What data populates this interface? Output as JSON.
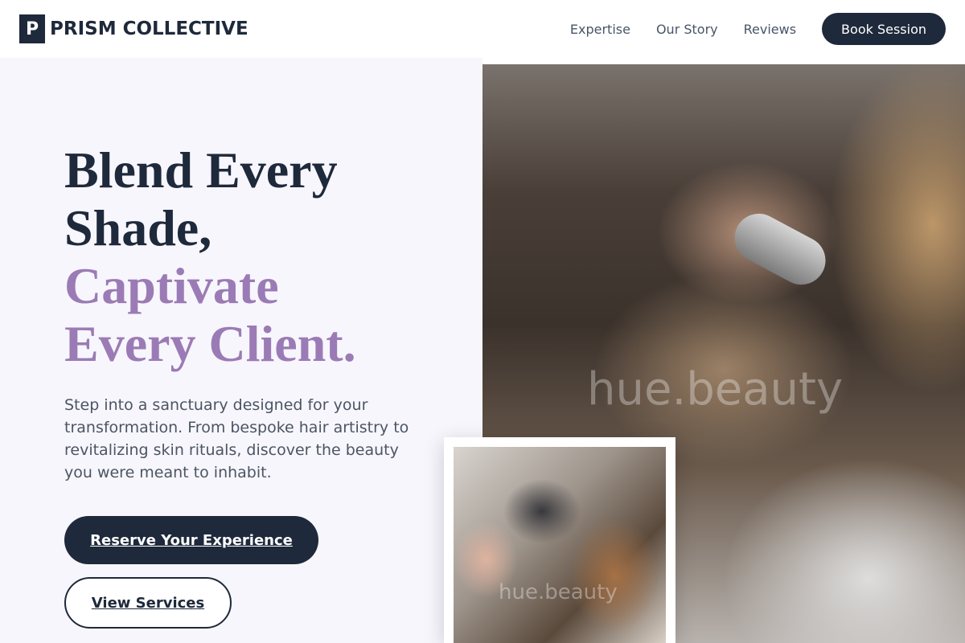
{
  "brand": {
    "logo_letter": "P",
    "name": "PRISM COLLECTIVE"
  },
  "nav": {
    "items": [
      "Expertise",
      "Our Story",
      "Reviews"
    ],
    "cta": "Book Session"
  },
  "hero": {
    "headline": {
      "line1": "Blend Every",
      "line2": "Shade,",
      "line3": "Captivate",
      "line4": "Every Client."
    },
    "description": "Step into a sanctuary designed for your transformation. From bespoke hair artistry to revitalizing skin rituals, discover the beauty you were meant to inhabit.",
    "primary_button": "Reserve Your Experience",
    "secondary_button": "View Services",
    "main_image_watermark": "hue.beauty",
    "inset_image_watermark": "hue.beauty"
  },
  "colors": {
    "primary": "#1e293b",
    "accent": "#9b7bb5",
    "hero_background": "#f7f6fc"
  }
}
